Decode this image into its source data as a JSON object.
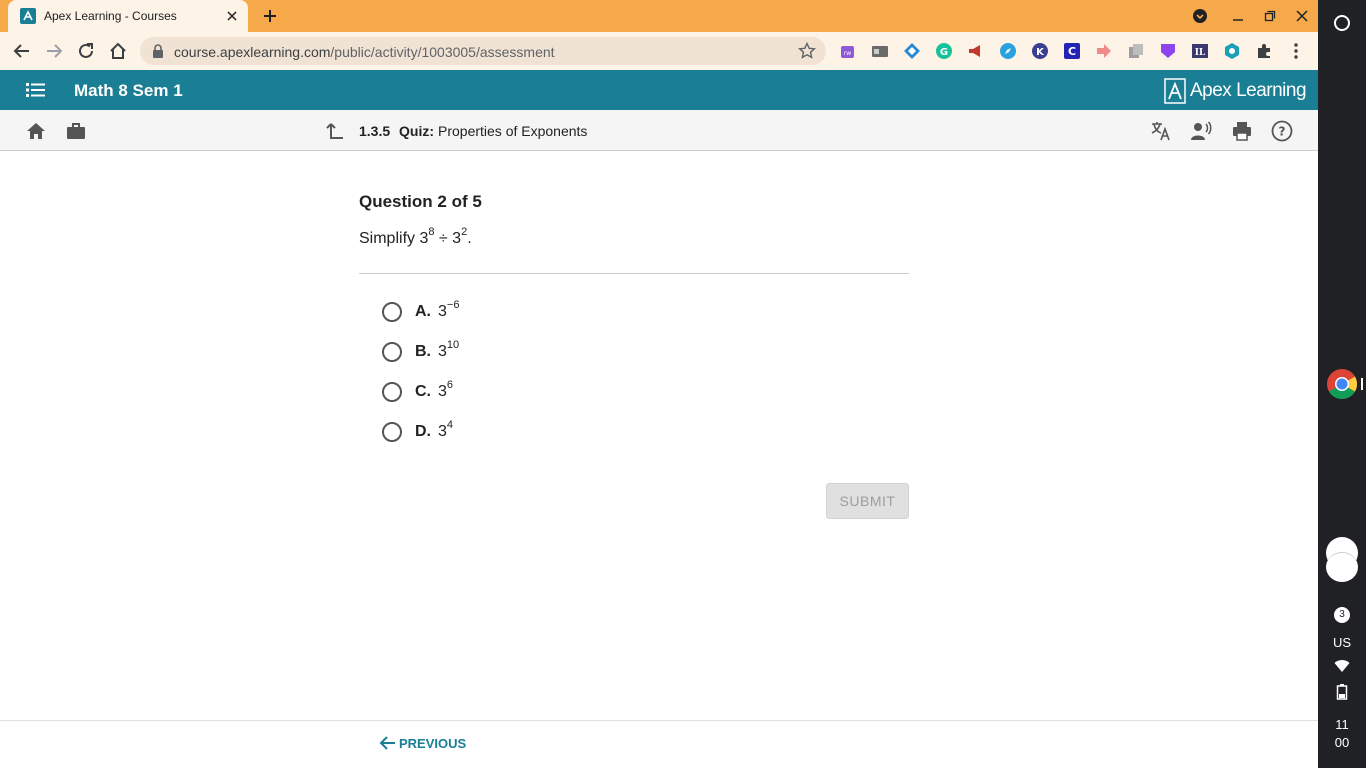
{
  "browser": {
    "tab_title": "Apex Learning - Courses",
    "url_host": "course.apexlearning.com",
    "url_path": "/public/activity/1003005/assessment"
  },
  "header": {
    "course_title": "Math 8 Sem 1",
    "brand": "Apex Learning"
  },
  "activity": {
    "number": "1.3.5",
    "type": "Quiz:",
    "name": "Properties of Exponents"
  },
  "question": {
    "heading": "Question 2 of 5",
    "prompt_prefix": "Simplify 3",
    "prompt_exp1": "8",
    "prompt_mid": " ÷ 3",
    "prompt_exp2": "2",
    "prompt_suffix": ".",
    "options": [
      {
        "letter": "A.",
        "base": "3",
        "exp": "−6"
      },
      {
        "letter": "B.",
        "base": "3",
        "exp": "10"
      },
      {
        "letter": "C.",
        "base": "3",
        "exp": "6"
      },
      {
        "letter": "D.",
        "base": "3",
        "exp": "4"
      }
    ],
    "submit_label": "SUBMIT"
  },
  "footer": {
    "previous_label": "PREVIOUS"
  },
  "shelf": {
    "notification_count": "3",
    "input_method": "US",
    "time_hour": "11",
    "time_minute": "00"
  },
  "colors": {
    "tab_strip": "#f6a94a",
    "apex_teal": "#1a7e94"
  }
}
